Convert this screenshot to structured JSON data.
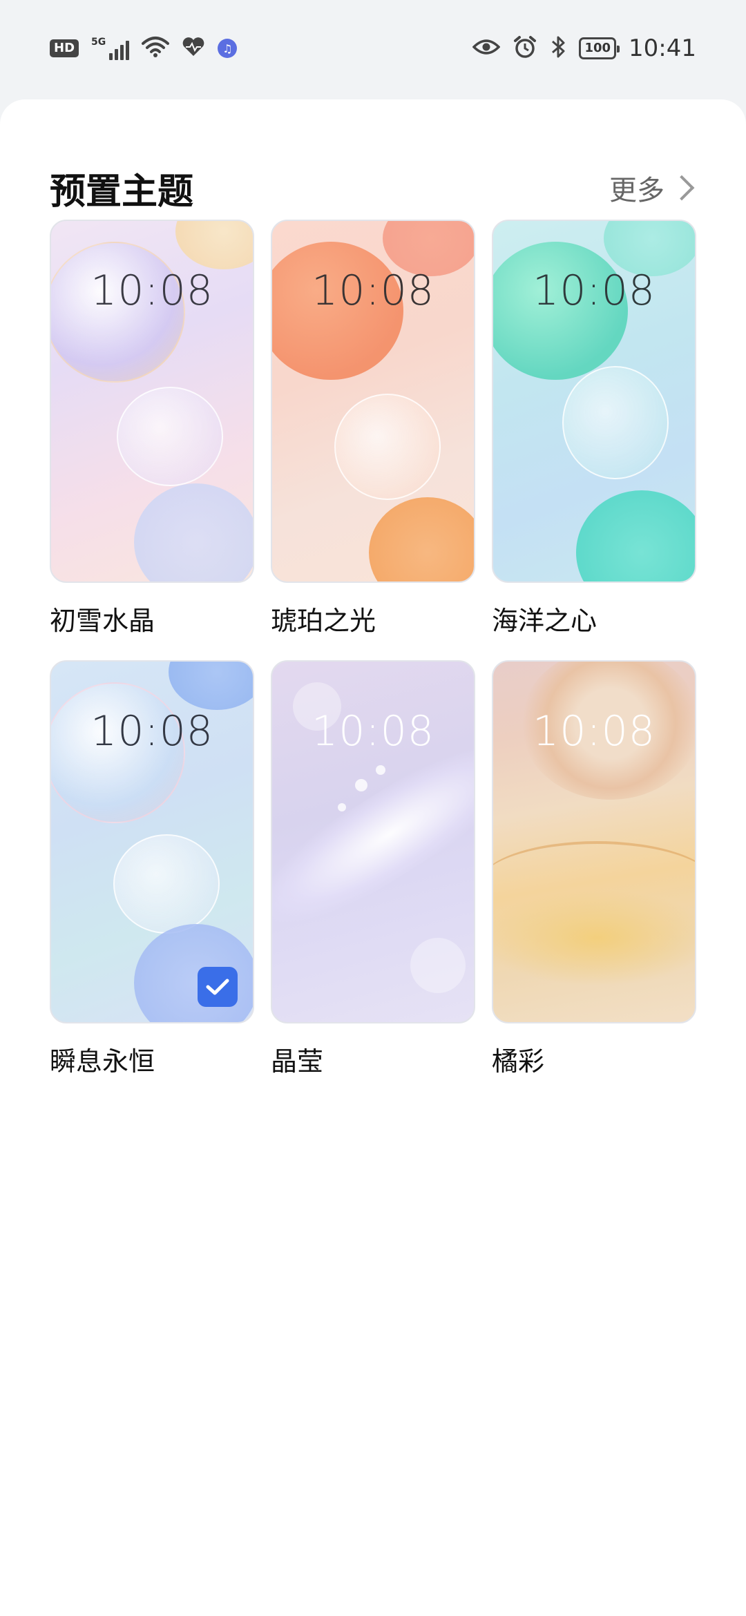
{
  "status_bar": {
    "left_badge": "HD",
    "network_tag": "5G",
    "battery": "100",
    "time": "10:41"
  },
  "section": {
    "title": "预置主题",
    "more_label": "更多"
  },
  "themes": [
    {
      "name": "初雪水晶",
      "clock": "10:08",
      "selected": false
    },
    {
      "name": "琥珀之光",
      "clock": "10:08",
      "selected": false
    },
    {
      "name": "海洋之心",
      "clock": "10:08",
      "selected": false
    },
    {
      "name": "瞬息永恒",
      "clock": "10:08",
      "selected": true
    },
    {
      "name": "晶莹",
      "clock": "10:08",
      "selected": false
    },
    {
      "name": "橘彩",
      "clock": "10:08",
      "selected": false
    }
  ],
  "colors": {
    "accent": "#3a6ee8",
    "background": "#f1f3f5",
    "sheet": "#ffffff"
  },
  "icons": [
    "hd-badge-icon",
    "signal-icon",
    "wifi-icon",
    "health-icon",
    "music-icon",
    "eye-icon",
    "alarm-icon",
    "bluetooth-icon",
    "battery-icon",
    "chevron-right-icon",
    "checkmark-icon"
  ]
}
